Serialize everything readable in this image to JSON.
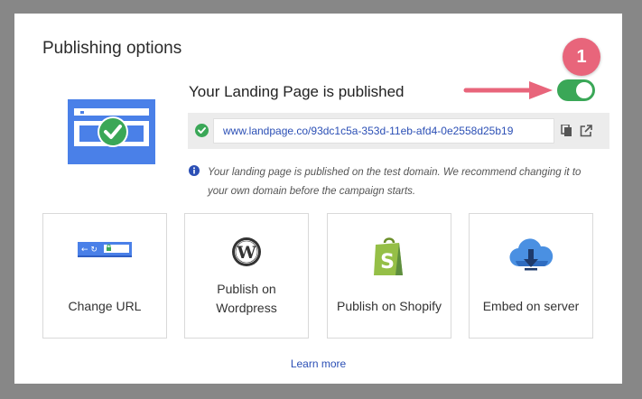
{
  "dialog": {
    "title": "Publishing options",
    "status_text": "Your Landing Page is published",
    "step_badge": "1",
    "publish_toggle_on": true,
    "url": "www.landpage.co/93dc1c5a-353d-11eb-afd4-0e2558d25b19",
    "info_text_line1": "Your landing page is published on the test domain. We recommend changing it to",
    "info_text_line2": "your own domain before the campaign starts.",
    "learn_more": "Learn more"
  },
  "cards": [
    {
      "label": "Change URL",
      "icon": "browser-url-icon"
    },
    {
      "label_line1": "Publish on",
      "label_line2": "Wordpress",
      "icon": "wordpress-icon"
    },
    {
      "label": "Publish on Shopify",
      "icon": "shopify-icon"
    },
    {
      "label": "Embed on server",
      "icon": "cloud-download-icon"
    }
  ],
  "colors": {
    "accent": "#3aa757",
    "link": "#2b4fb5",
    "badge": "#e8657b",
    "hero_blue": "#4a80e8"
  }
}
